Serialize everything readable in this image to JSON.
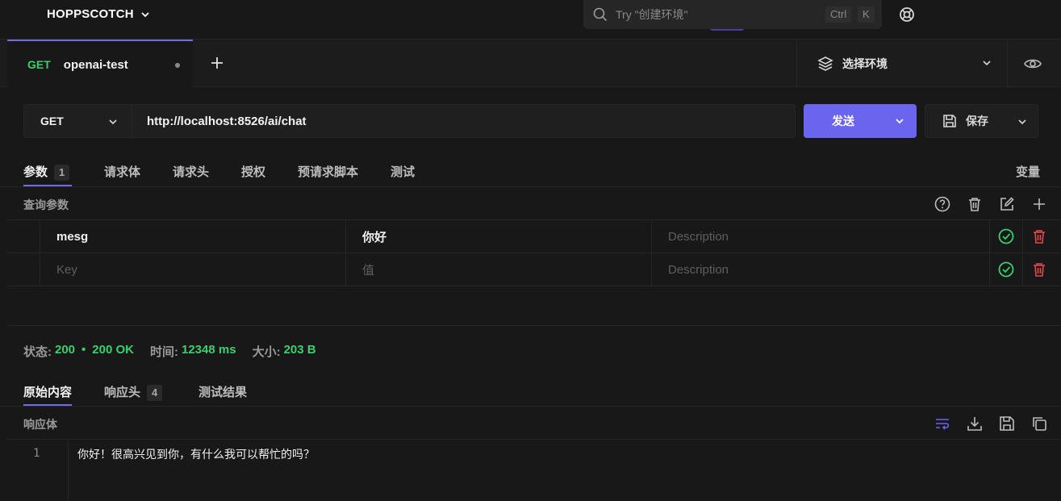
{
  "app": {
    "brand": "HOPPSCOTCH",
    "search_placeholder": "Try \"创建环境\"",
    "shortcut_mod": "Ctrl",
    "shortcut_key": "K"
  },
  "tab": {
    "method": "GET",
    "name": "openai-test"
  },
  "environment": {
    "label": "选择环境"
  },
  "request": {
    "method": "GET",
    "url": "http://localhost:8526/ai/chat",
    "send_label": "发送",
    "save_label": "保存"
  },
  "request_tabs": [
    {
      "label": "参数",
      "badge": "1"
    },
    {
      "label": "请求体"
    },
    {
      "label": "请求头"
    },
    {
      "label": "授权"
    },
    {
      "label": "预请求脚本"
    },
    {
      "label": "测试"
    }
  ],
  "variables_label": "变量",
  "params": {
    "section_label": "查询参数",
    "rows": [
      {
        "key": "mesg",
        "value": "你好",
        "description_placeholder": "Description"
      },
      {
        "key_placeholder": "Key",
        "value_placeholder": "值",
        "description_placeholder": "Description"
      }
    ]
  },
  "response": {
    "status_label": "状态:",
    "status_code": "200",
    "status_text": "200 OK",
    "time_label": "时间:",
    "time_value": "12348 ms",
    "size_label": "大小:",
    "size_value": "203 B",
    "tabs": [
      {
        "label": "原始内容"
      },
      {
        "label": "响应头",
        "badge": "4"
      },
      {
        "label": "测试结果"
      }
    ],
    "body_label": "响应体",
    "line_number": "1",
    "body_text": "你好！很高兴见到你，有什么我可以帮忙的吗？"
  },
  "colors": {
    "accent": "#6a64ef",
    "success": "#3bcf6d",
    "danger": "#e5484d"
  }
}
